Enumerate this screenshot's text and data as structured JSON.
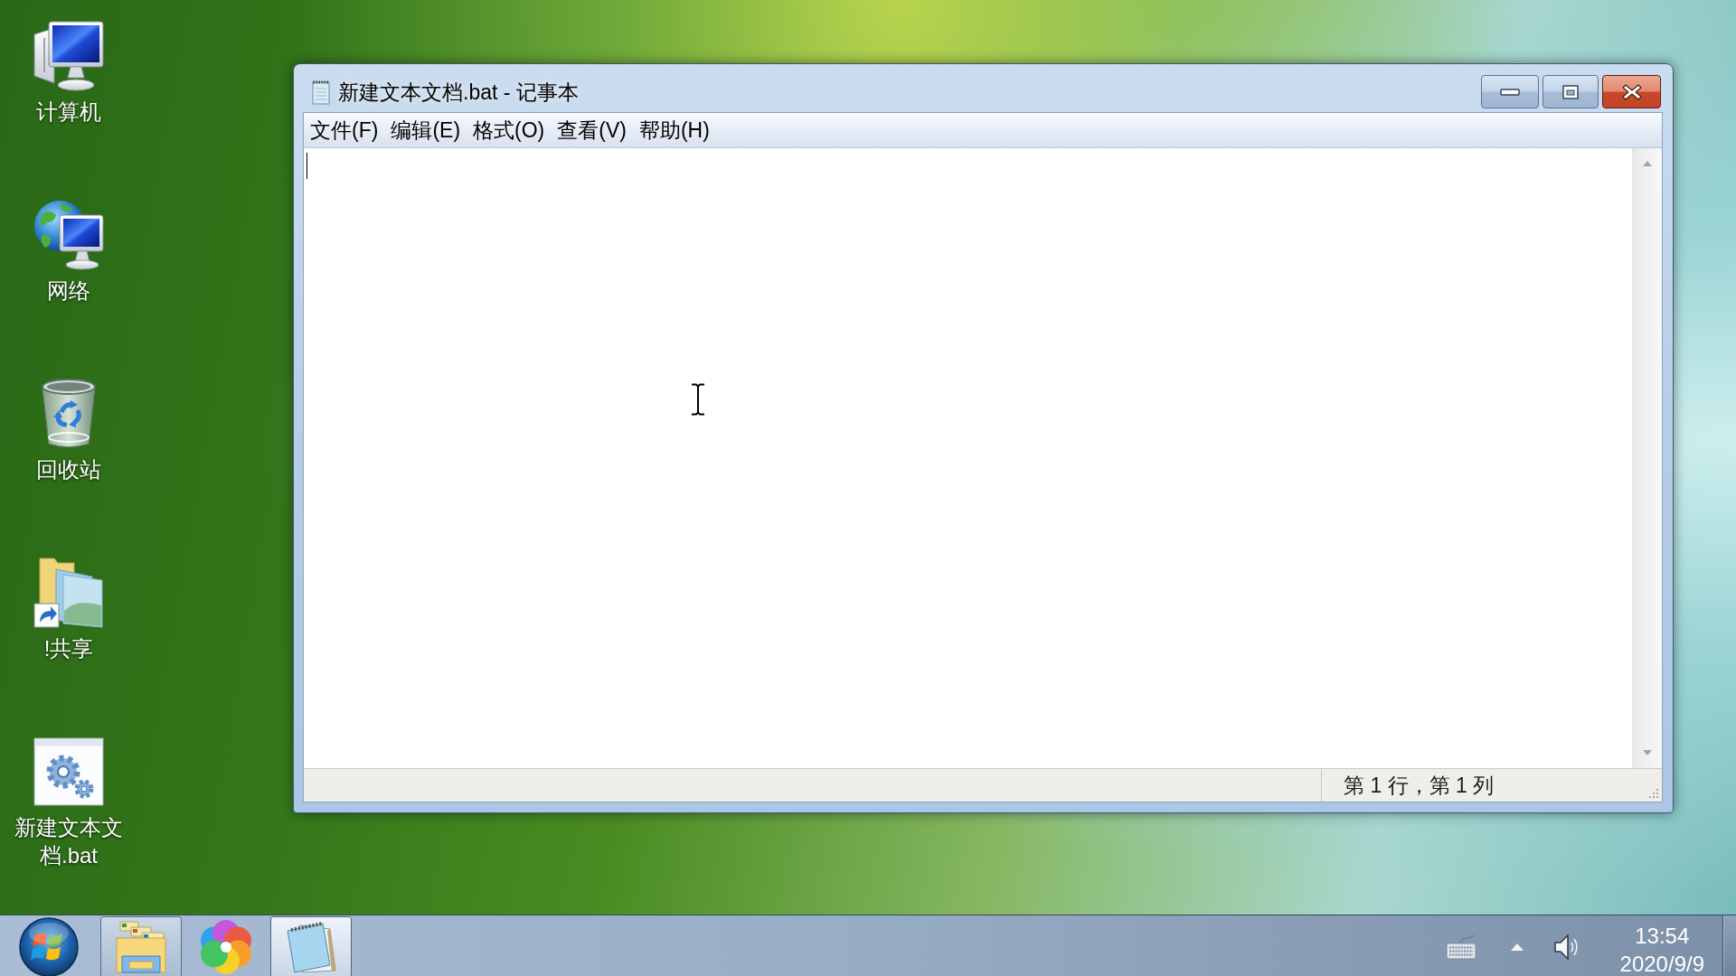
{
  "desktop": {
    "icons": [
      {
        "kind": "computer",
        "label": "计算机"
      },
      {
        "kind": "network",
        "label": "网络"
      },
      {
        "kind": "recyclebin",
        "label": "回收站"
      },
      {
        "kind": "shortcut",
        "label": "!共享"
      },
      {
        "kind": "script",
        "label": "新建文本文档.bat"
      }
    ]
  },
  "window": {
    "title": "新建文本文档.bat - 记事本",
    "menu": [
      {
        "label": "文件(F)"
      },
      {
        "label": "编辑(E)"
      },
      {
        "label": "格式(O)"
      },
      {
        "label": "查看(V)"
      },
      {
        "label": "帮助(H)"
      }
    ],
    "status_bar": {
      "position": "第 1 行，第 1 列"
    }
  },
  "taskbar": {
    "apps": [
      {
        "kind": "explorer",
        "running": true,
        "selected": false
      },
      {
        "kind": "browser",
        "running": false,
        "selected": false
      },
      {
        "kind": "notepad",
        "running": true,
        "selected": true
      }
    ],
    "clock": {
      "time": "13:54",
      "date": "2020/9/9"
    }
  }
}
